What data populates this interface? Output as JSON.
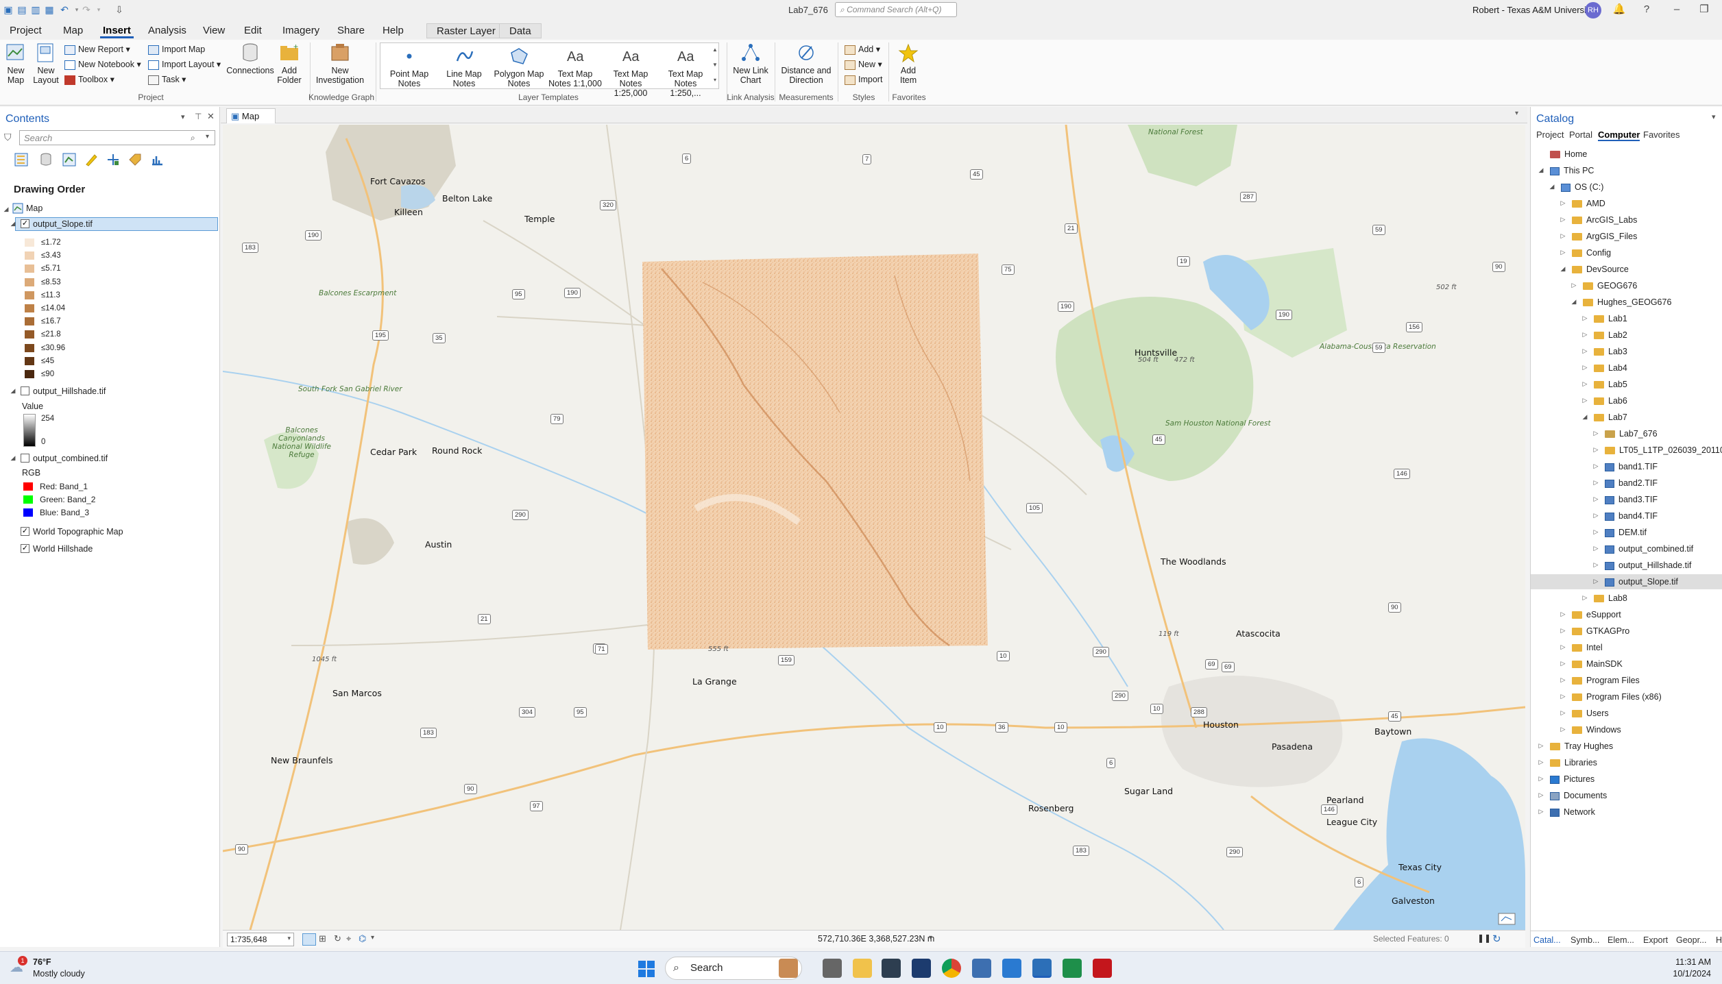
{
  "titlebar": {
    "doc_title": "Lab7_676",
    "command_search_placeholder": "Command Search (Alt+Q)",
    "user_name": "Robert - Texas A&M University",
    "avatar_initials": "RH"
  },
  "menu": {
    "tabs": [
      "Project",
      "Map",
      "Insert",
      "Analysis",
      "View",
      "Edit",
      "Imagery",
      "Share",
      "Help"
    ],
    "active_tab": "Insert",
    "contextual_tabs": [
      "Raster Layer",
      "Data"
    ]
  },
  "ribbon": {
    "project": {
      "new_map": "New Map",
      "new_layout": "New Layout",
      "new_report": "New Report",
      "new_notebook": "New Notebook",
      "toolbox": "Toolbox",
      "import_map": "Import Map",
      "import_layout": "Import Layout",
      "task": "Task",
      "connections": "Connections",
      "add_folder": "Add Folder",
      "group_label": "Project"
    },
    "knowledge_graph": {
      "new_investigation": "New Investigation",
      "group_label": "Knowledge Graph"
    },
    "layer_templates": {
      "items": [
        "Point Map Notes",
        "Line Map Notes",
        "Polygon Map Notes",
        "Text Map Notes 1:1,000",
        "Text Map Notes 1:25,000",
        "Text Map Notes 1:250,..."
      ],
      "group_label": "Layer Templates"
    },
    "link_analysis": {
      "new_link_chart": "New Link Chart",
      "group_label": "Link Analysis"
    },
    "measurements": {
      "distance_direction": "Distance and Direction",
      "group_label": "Measurements"
    },
    "styles": {
      "add": "Add",
      "new": "New",
      "import": "Import",
      "group_label": "Styles"
    },
    "favorites": {
      "add_item": "Add Item",
      "group_label": "Favorites"
    }
  },
  "contents": {
    "title": "Contents",
    "search_placeholder": "Search",
    "drawing_order": "Drawing Order",
    "map_name": "Map",
    "slope_layer": "output_Slope.tif",
    "slope_classes": [
      "≤1.72",
      "≤3.43",
      "≤5.71",
      "≤8.53",
      "≤11.3",
      "≤14.04",
      "≤16.7",
      "≤21.8",
      "≤30.96",
      "≤45",
      "≤90"
    ],
    "slope_colors": [
      "#f7e8d8",
      "#f1d3b5",
      "#e8bf96",
      "#dcaa78",
      "#cf9760",
      "#be8147",
      "#aa6d36",
      "#945a28",
      "#7c481d",
      "#633715",
      "#4a280f"
    ],
    "hillshade_layer": "output_Hillshade.tif",
    "hillshade_value_label": "Value",
    "hillshade_max": "254",
    "hillshade_min": "0",
    "combined_layer": "output_combined.tif",
    "rgb_label": "RGB",
    "rgb_bands": [
      "Red:   Band_1",
      "Green: Band_2",
      "Blue:  Band_3"
    ],
    "basemap_topo": "World Topographic Map",
    "basemap_hillshade": "World Hillshade"
  },
  "map": {
    "tab_label": "Map",
    "scale": "1:735,648",
    "coordinates": "572,710.36E 3,368,527.23N m",
    "selected_features": "Selected Features: 0",
    "cities": [
      "Killeen",
      "Temple",
      "Fort Cavazos",
      "Belton Lake",
      "Cedar Park",
      "Round Rock",
      "Austin",
      "San Marcos",
      "New Braunfels",
      "La Grange",
      "Huntsville",
      "The Woodlands",
      "Atascocita",
      "Houston",
      "Pasadena",
      "Baytown",
      "Sugar Land",
      "Rosenberg",
      "Pearland",
      "League City",
      "Texas City",
      "Galveston"
    ],
    "features": [
      "Balcones Escarpment",
      "Balcones Canyonlands National Wildlife Refuge",
      "Sam Houston National Forest",
      "Alabama-Coushatta Reservation",
      "South Fork San Gabriel River",
      "National Forest"
    ],
    "elevations": [
      "504 ft",
      "472 ft",
      "502 ft",
      "119 ft",
      "1045 ft",
      "555 ft"
    ],
    "roads": [
      "190",
      "183",
      "195",
      "35",
      "95",
      "190",
      "79",
      "6",
      "7",
      "45",
      "21",
      "19",
      "75",
      "190",
      "320",
      "290",
      "21",
      "71",
      "159",
      "304",
      "95",
      "183",
      "90",
      "97",
      "90",
      "10",
      "36",
      "10",
      "10",
      "290",
      "6",
      "69",
      "59",
      "146",
      "105",
      "90",
      "287",
      "59",
      "190",
      "156",
      "90",
      "45",
      "288",
      "146",
      "6",
      "183",
      "290",
      "290",
      "10",
      "45",
      "69",
      "71"
    ]
  },
  "catalog": {
    "title": "Catalog",
    "tabs": [
      "Project",
      "Portal",
      "Computer",
      "Favorites"
    ],
    "active_tab": "Computer",
    "tree": [
      {
        "label": "Home",
        "level": 0,
        "type": "home"
      },
      {
        "label": "This PC",
        "level": 0,
        "type": "pc"
      },
      {
        "label": "OS (C:)",
        "level": 1,
        "type": "drive"
      },
      {
        "label": "AMD",
        "level": 2,
        "type": "folder"
      },
      {
        "label": "ArcGIS_Labs",
        "level": 2,
        "type": "folder"
      },
      {
        "label": "ArgGIS_Files",
        "level": 2,
        "type": "folder"
      },
      {
        "label": "Config",
        "level": 2,
        "type": "folder"
      },
      {
        "label": "DevSource",
        "level": 2,
        "type": "folder"
      },
      {
        "label": "GEOG676",
        "level": 3,
        "type": "folder"
      },
      {
        "label": "Hughes_GEOG676",
        "level": 3,
        "type": "folder"
      },
      {
        "label": "Lab1",
        "level": 4,
        "type": "folder"
      },
      {
        "label": "Lab2",
        "level": 4,
        "type": "folder"
      },
      {
        "label": "Lab3",
        "level": 4,
        "type": "folder"
      },
      {
        "label": "Lab4",
        "level": 4,
        "type": "folder"
      },
      {
        "label": "Lab5",
        "level": 4,
        "type": "folder"
      },
      {
        "label": "Lab6",
        "level": 4,
        "type": "folder"
      },
      {
        "label": "Lab7",
        "level": 4,
        "type": "folder"
      },
      {
        "label": "Lab7_676",
        "level": 5,
        "type": "gdb"
      },
      {
        "label": "LT05_L1TP_026039_20110819",
        "level": 5,
        "type": "folder"
      },
      {
        "label": "band1.TIF",
        "level": 5,
        "type": "raster"
      },
      {
        "label": "band2.TIF",
        "level": 5,
        "type": "raster"
      },
      {
        "label": "band3.TIF",
        "level": 5,
        "type": "raster"
      },
      {
        "label": "band4.TIF",
        "level": 5,
        "type": "raster"
      },
      {
        "label": "DEM.tif",
        "level": 5,
        "type": "raster"
      },
      {
        "label": "output_combined.tif",
        "level": 5,
        "type": "raster"
      },
      {
        "label": "output_Hillshade.tif",
        "level": 5,
        "type": "raster"
      },
      {
        "label": "output_Slope.tif",
        "level": 5,
        "type": "raster"
      },
      {
        "label": "Lab8",
        "level": 4,
        "type": "folder"
      },
      {
        "label": "eSupport",
        "level": 2,
        "type": "folder"
      },
      {
        "label": "GTKAGPro",
        "level": 2,
        "type": "folder"
      },
      {
        "label": "Intel",
        "level": 2,
        "type": "folder"
      },
      {
        "label": "MainSDK",
        "level": 2,
        "type": "folder"
      },
      {
        "label": "Program Files",
        "level": 2,
        "type": "folder"
      },
      {
        "label": "Program Files (x86)",
        "level": 2,
        "type": "folder"
      },
      {
        "label": "Users",
        "level": 2,
        "type": "folder"
      },
      {
        "label": "Windows",
        "level": 2,
        "type": "folder"
      },
      {
        "label": "Tray Hughes",
        "level": 0,
        "type": "folder"
      },
      {
        "label": "Libraries",
        "level": 0,
        "type": "folder"
      },
      {
        "label": "Pictures",
        "level": 0,
        "type": "pics"
      },
      {
        "label": "Documents",
        "level": 0,
        "type": "docs"
      },
      {
        "label": "Network",
        "level": 0,
        "type": "net"
      }
    ],
    "bottom_tabs": [
      "Catal...",
      "Symb...",
      "Elem...",
      "Export",
      "Geopr...",
      "H"
    ]
  },
  "taskbar": {
    "weather_temp": "76°F",
    "weather_desc": "Mostly cloudy",
    "search": "Search",
    "time": "11:31 AM",
    "date": "10/1/2024",
    "weather_badge": "1"
  },
  "colors": {
    "accent": "#1f5fb9",
    "slope_raster": "#f0c8a0",
    "water": "#a9d1ef",
    "forest": "#cfe2c0"
  }
}
